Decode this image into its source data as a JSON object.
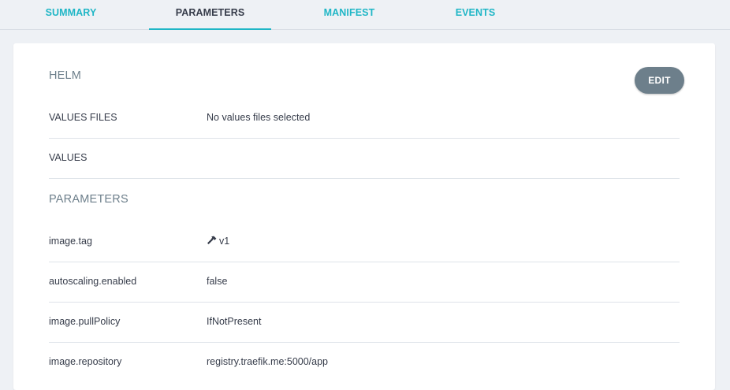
{
  "tabs": [
    {
      "label": "SUMMARY",
      "active": false
    },
    {
      "label": "PARAMETERS",
      "active": true
    },
    {
      "label": "MANIFEST",
      "active": false
    },
    {
      "label": "EVENTS",
      "active": false
    }
  ],
  "helm": {
    "title": "HELM",
    "edit_label": "EDIT",
    "values_files_label": "VALUES FILES",
    "values_files_value": "No values files selected",
    "values_label": "VALUES",
    "values_value": ""
  },
  "parameters": {
    "title": "PARAMETERS",
    "rows": [
      {
        "key": "image.tag",
        "value": "v1",
        "icon": "hammer-icon"
      },
      {
        "key": "autoscaling.enabled",
        "value": "false"
      },
      {
        "key": "image.pullPolicy",
        "value": "IfNotPresent"
      },
      {
        "key": "image.repository",
        "value": "registry.traefik.me:5000/app"
      }
    ]
  },
  "colors": {
    "accent": "#1fb6c6",
    "edit_button": "#6d7f8b",
    "background": "#eef1f5",
    "text": "#363c4a"
  }
}
